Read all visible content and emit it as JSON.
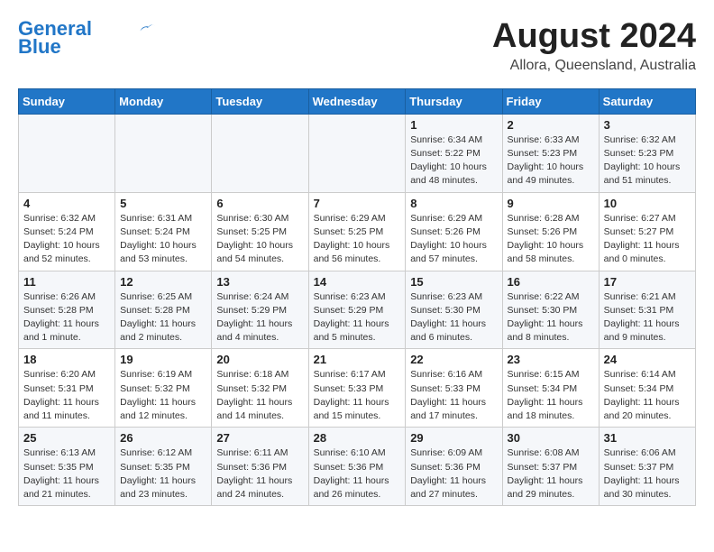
{
  "header": {
    "logo_line1": "General",
    "logo_line2": "Blue",
    "month_year": "August 2024",
    "location": "Allora, Queensland, Australia"
  },
  "weekdays": [
    "Sunday",
    "Monday",
    "Tuesday",
    "Wednesday",
    "Thursday",
    "Friday",
    "Saturday"
  ],
  "weeks": [
    [
      {
        "day": "",
        "info": ""
      },
      {
        "day": "",
        "info": ""
      },
      {
        "day": "",
        "info": ""
      },
      {
        "day": "",
        "info": ""
      },
      {
        "day": "1",
        "info": "Sunrise: 6:34 AM\nSunset: 5:22 PM\nDaylight: 10 hours\nand 48 minutes."
      },
      {
        "day": "2",
        "info": "Sunrise: 6:33 AM\nSunset: 5:23 PM\nDaylight: 10 hours\nand 49 minutes."
      },
      {
        "day": "3",
        "info": "Sunrise: 6:32 AM\nSunset: 5:23 PM\nDaylight: 10 hours\nand 51 minutes."
      }
    ],
    [
      {
        "day": "4",
        "info": "Sunrise: 6:32 AM\nSunset: 5:24 PM\nDaylight: 10 hours\nand 52 minutes."
      },
      {
        "day": "5",
        "info": "Sunrise: 6:31 AM\nSunset: 5:24 PM\nDaylight: 10 hours\nand 53 minutes."
      },
      {
        "day": "6",
        "info": "Sunrise: 6:30 AM\nSunset: 5:25 PM\nDaylight: 10 hours\nand 54 minutes."
      },
      {
        "day": "7",
        "info": "Sunrise: 6:29 AM\nSunset: 5:25 PM\nDaylight: 10 hours\nand 56 minutes."
      },
      {
        "day": "8",
        "info": "Sunrise: 6:29 AM\nSunset: 5:26 PM\nDaylight: 10 hours\nand 57 minutes."
      },
      {
        "day": "9",
        "info": "Sunrise: 6:28 AM\nSunset: 5:26 PM\nDaylight: 10 hours\nand 58 minutes."
      },
      {
        "day": "10",
        "info": "Sunrise: 6:27 AM\nSunset: 5:27 PM\nDaylight: 11 hours\nand 0 minutes."
      }
    ],
    [
      {
        "day": "11",
        "info": "Sunrise: 6:26 AM\nSunset: 5:28 PM\nDaylight: 11 hours\nand 1 minute."
      },
      {
        "day": "12",
        "info": "Sunrise: 6:25 AM\nSunset: 5:28 PM\nDaylight: 11 hours\nand 2 minutes."
      },
      {
        "day": "13",
        "info": "Sunrise: 6:24 AM\nSunset: 5:29 PM\nDaylight: 11 hours\nand 4 minutes."
      },
      {
        "day": "14",
        "info": "Sunrise: 6:23 AM\nSunset: 5:29 PM\nDaylight: 11 hours\nand 5 minutes."
      },
      {
        "day": "15",
        "info": "Sunrise: 6:23 AM\nSunset: 5:30 PM\nDaylight: 11 hours\nand 6 minutes."
      },
      {
        "day": "16",
        "info": "Sunrise: 6:22 AM\nSunset: 5:30 PM\nDaylight: 11 hours\nand 8 minutes."
      },
      {
        "day": "17",
        "info": "Sunrise: 6:21 AM\nSunset: 5:31 PM\nDaylight: 11 hours\nand 9 minutes."
      }
    ],
    [
      {
        "day": "18",
        "info": "Sunrise: 6:20 AM\nSunset: 5:31 PM\nDaylight: 11 hours\nand 11 minutes."
      },
      {
        "day": "19",
        "info": "Sunrise: 6:19 AM\nSunset: 5:32 PM\nDaylight: 11 hours\nand 12 minutes."
      },
      {
        "day": "20",
        "info": "Sunrise: 6:18 AM\nSunset: 5:32 PM\nDaylight: 11 hours\nand 14 minutes."
      },
      {
        "day": "21",
        "info": "Sunrise: 6:17 AM\nSunset: 5:33 PM\nDaylight: 11 hours\nand 15 minutes."
      },
      {
        "day": "22",
        "info": "Sunrise: 6:16 AM\nSunset: 5:33 PM\nDaylight: 11 hours\nand 17 minutes."
      },
      {
        "day": "23",
        "info": "Sunrise: 6:15 AM\nSunset: 5:34 PM\nDaylight: 11 hours\nand 18 minutes."
      },
      {
        "day": "24",
        "info": "Sunrise: 6:14 AM\nSunset: 5:34 PM\nDaylight: 11 hours\nand 20 minutes."
      }
    ],
    [
      {
        "day": "25",
        "info": "Sunrise: 6:13 AM\nSunset: 5:35 PM\nDaylight: 11 hours\nand 21 minutes."
      },
      {
        "day": "26",
        "info": "Sunrise: 6:12 AM\nSunset: 5:35 PM\nDaylight: 11 hours\nand 23 minutes."
      },
      {
        "day": "27",
        "info": "Sunrise: 6:11 AM\nSunset: 5:36 PM\nDaylight: 11 hours\nand 24 minutes."
      },
      {
        "day": "28",
        "info": "Sunrise: 6:10 AM\nSunset: 5:36 PM\nDaylight: 11 hours\nand 26 minutes."
      },
      {
        "day": "29",
        "info": "Sunrise: 6:09 AM\nSunset: 5:36 PM\nDaylight: 11 hours\nand 27 minutes."
      },
      {
        "day": "30",
        "info": "Sunrise: 6:08 AM\nSunset: 5:37 PM\nDaylight: 11 hours\nand 29 minutes."
      },
      {
        "day": "31",
        "info": "Sunrise: 6:06 AM\nSunset: 5:37 PM\nDaylight: 11 hours\nand 30 minutes."
      }
    ]
  ]
}
